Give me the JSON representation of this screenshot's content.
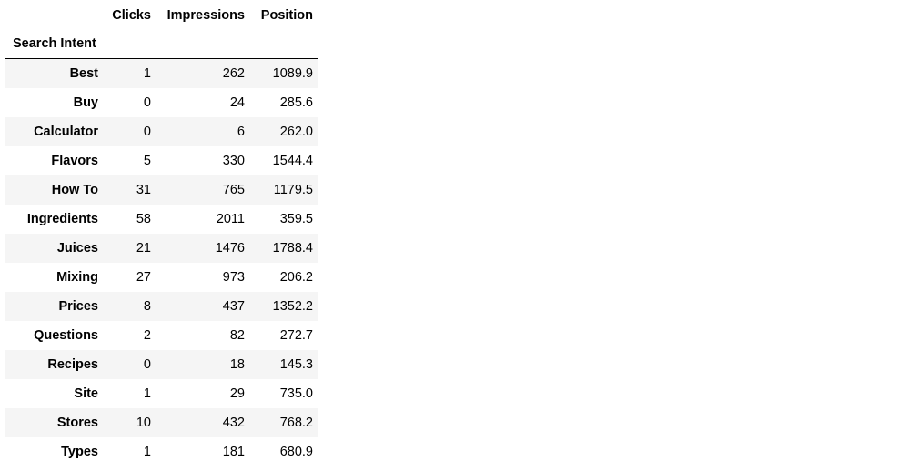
{
  "table": {
    "columns": [
      "Clicks",
      "Impressions",
      "Position"
    ],
    "index_name": "Search Intent",
    "rows": [
      {
        "label": "Best",
        "clicks": "1",
        "impressions": "262",
        "position": "1089.9"
      },
      {
        "label": "Buy",
        "clicks": "0",
        "impressions": "24",
        "position": "285.6"
      },
      {
        "label": "Calculator",
        "clicks": "0",
        "impressions": "6",
        "position": "262.0"
      },
      {
        "label": "Flavors",
        "clicks": "5",
        "impressions": "330",
        "position": "1544.4"
      },
      {
        "label": "How To",
        "clicks": "31",
        "impressions": "765",
        "position": "1179.5"
      },
      {
        "label": "Ingredients",
        "clicks": "58",
        "impressions": "2011",
        "position": "359.5"
      },
      {
        "label": "Juices",
        "clicks": "21",
        "impressions": "1476",
        "position": "1788.4"
      },
      {
        "label": "Mixing",
        "clicks": "27",
        "impressions": "973",
        "position": "206.2"
      },
      {
        "label": "Prices",
        "clicks": "8",
        "impressions": "437",
        "position": "1352.2"
      },
      {
        "label": "Questions",
        "clicks": "2",
        "impressions": "82",
        "position": "272.7"
      },
      {
        "label": "Recipes",
        "clicks": "0",
        "impressions": "18",
        "position": "145.3"
      },
      {
        "label": "Site",
        "clicks": "1",
        "impressions": "29",
        "position": "735.0"
      },
      {
        "label": "Stores",
        "clicks": "10",
        "impressions": "432",
        "position": "768.2"
      },
      {
        "label": "Types",
        "clicks": "1",
        "impressions": "181",
        "position": "680.9"
      }
    ]
  }
}
